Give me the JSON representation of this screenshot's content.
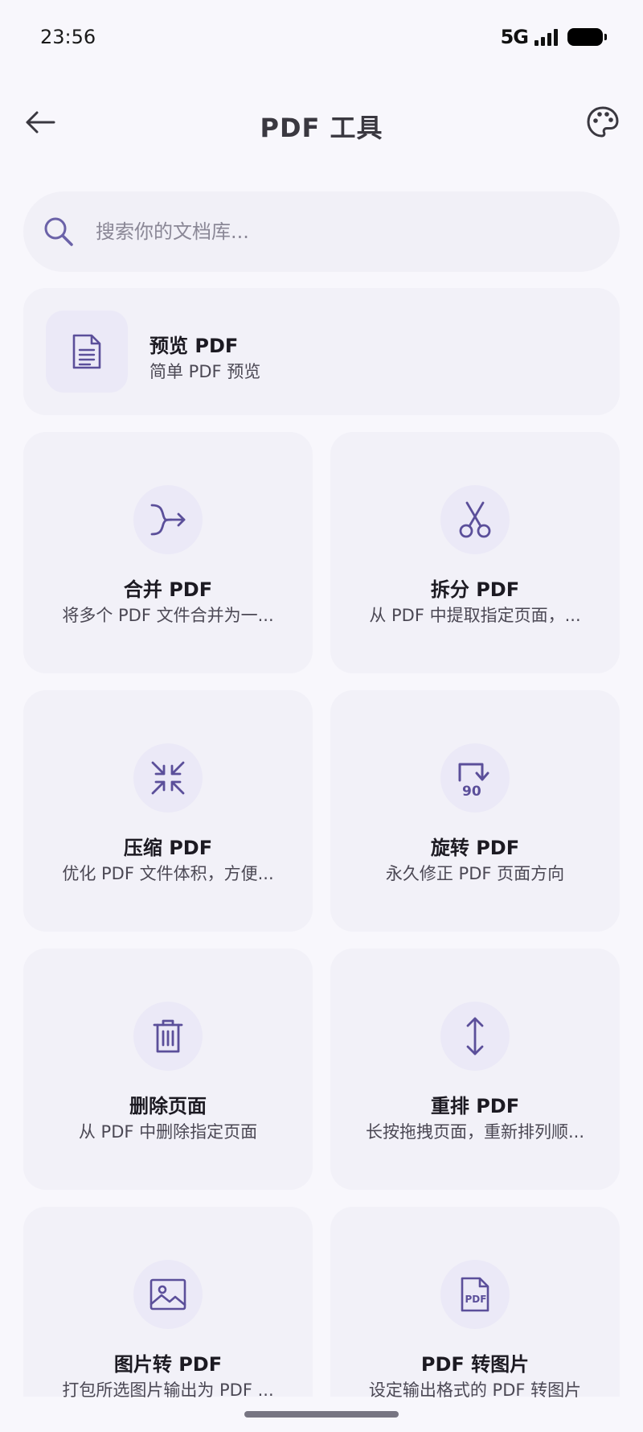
{
  "status_bar": {
    "time": "23:56",
    "network": "5G",
    "battery_icon": "battery-full-icon",
    "signal_icon": "signal-bars-icon"
  },
  "header": {
    "title": "PDF 工具",
    "back_icon": "arrow-left-icon",
    "palette_icon": "palette-icon"
  },
  "search": {
    "placeholder": "搜索你的文档库...",
    "icon": "search-icon"
  },
  "featured": {
    "title": "预览 PDF",
    "desc": "简单 PDF 预览",
    "icon": "document-icon"
  },
  "tools": [
    {
      "title": "合并 PDF",
      "desc": "将多个 PDF 文件合并为一...",
      "icon": "merge-arrow-icon"
    },
    {
      "title": "拆分 PDF",
      "desc": "从 PDF 中提取指定页面，...",
      "icon": "scissors-icon"
    },
    {
      "title": "压缩 PDF",
      "desc": "优化 PDF 文件体积，方便...",
      "icon": "compress-arrows-icon"
    },
    {
      "title": "旋转 PDF",
      "desc": "永久修正 PDF 页面方向",
      "icon": "rotate-90-icon",
      "icon_text": "90"
    },
    {
      "title": "删除页面",
      "desc": "从 PDF 中删除指定页面",
      "icon": "trash-icon"
    },
    {
      "title": "重排 PDF",
      "desc": "长按拖拽页面，重新排列顺...",
      "icon": "vertical-arrows-icon"
    },
    {
      "title": "图片转 PDF",
      "desc": "打包所选图片输出为 PDF ...",
      "icon": "image-icon"
    },
    {
      "title": "PDF 转图片",
      "desc": "设定输出格式的 PDF 转图片",
      "icon": "pdf-file-icon",
      "icon_text": "PDF"
    }
  ],
  "colors": {
    "accent": "#5b4f9a",
    "card_bg": "#f2f1f8",
    "icon_bg": "#ebe9f7",
    "page_bg": "#f8f7fc"
  }
}
